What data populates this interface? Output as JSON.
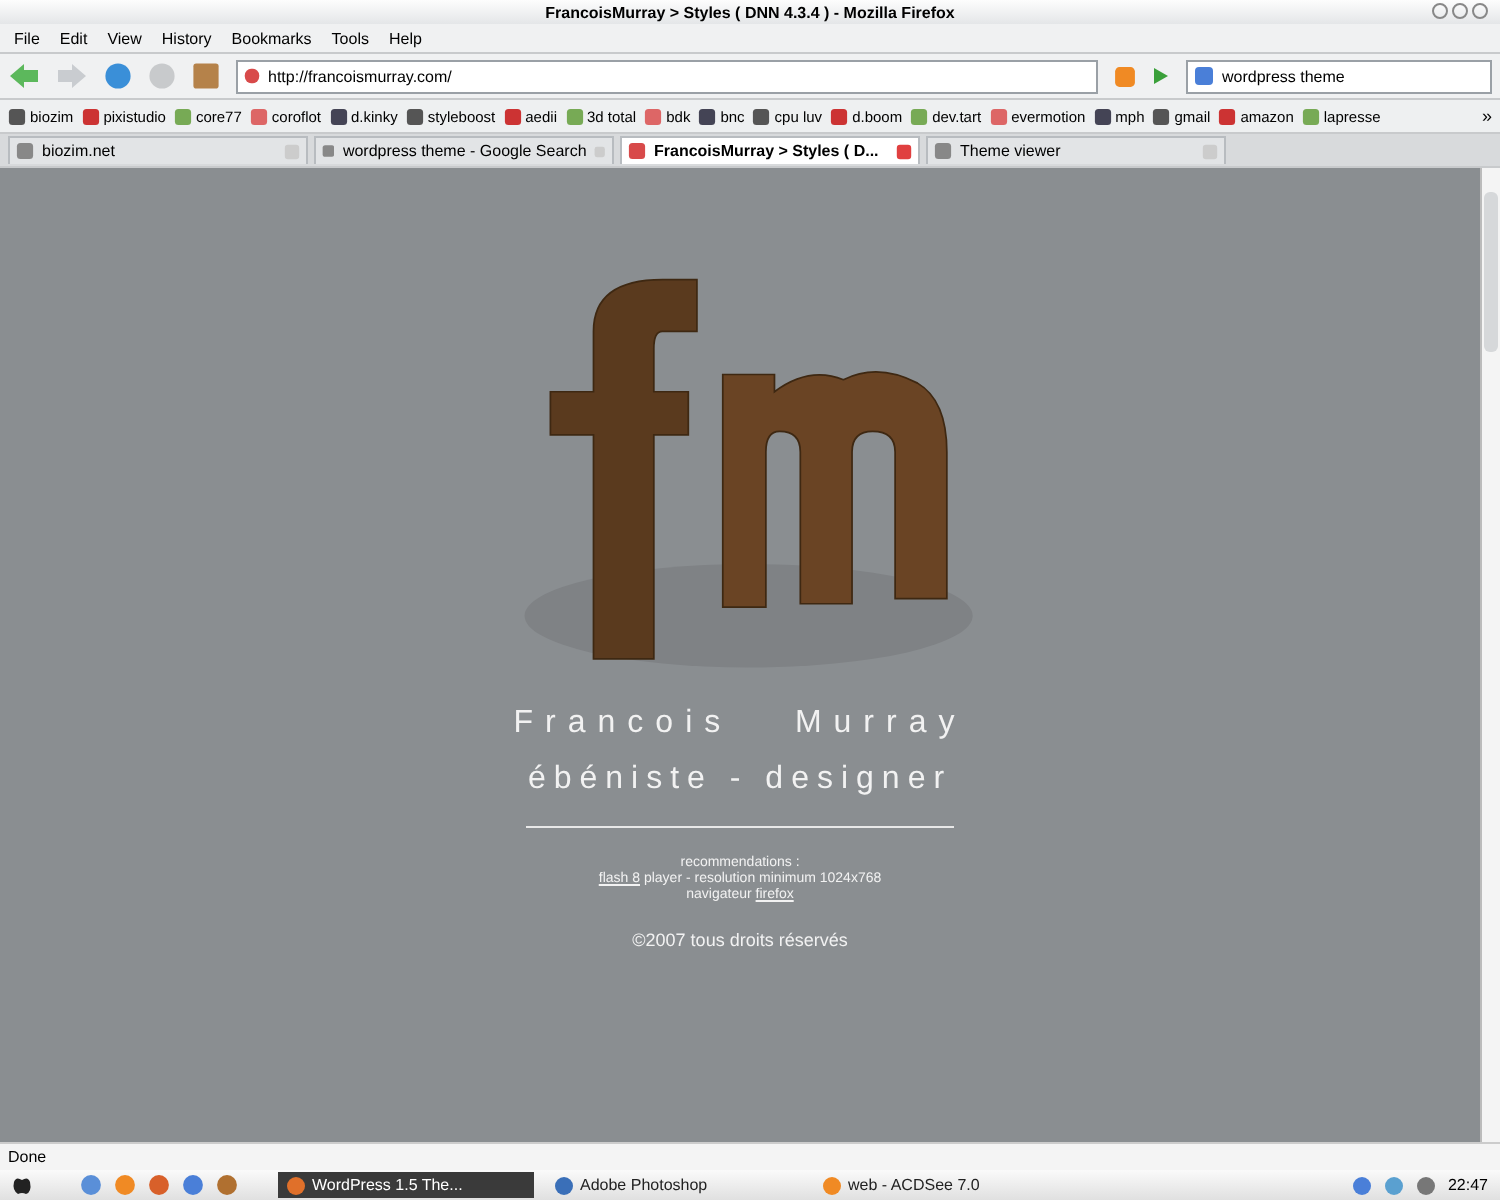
{
  "window": {
    "title": "FrancoisMurray > Styles ( DNN 4.3.4 ) - Mozilla Firefox"
  },
  "menu": [
    "File",
    "Edit",
    "View",
    "History",
    "Bookmarks",
    "Tools",
    "Help"
  ],
  "address": {
    "value": "http://francoismurray.com/"
  },
  "search": {
    "value": "wordpress theme"
  },
  "bookmarks": [
    "biozim",
    "pixistudio",
    "core77",
    "coroflot",
    "d.kinky",
    "styleboost",
    "aedii",
    "3d total",
    "bdk",
    "bnc",
    "cpu luv",
    "d.boom",
    "dev.tart",
    "evermotion",
    "mph",
    "gmail",
    "amazon",
    "lapresse"
  ],
  "bookmarks_more": "»",
  "tabs": [
    {
      "label": "biozim.net",
      "selected": false
    },
    {
      "label": "wordpress theme - Google Search",
      "selected": false
    },
    {
      "label": "FrancoisMurray > Styles ( D...",
      "selected": true
    },
    {
      "label": "Theme viewer",
      "selected": false
    }
  ],
  "page": {
    "name": "Francois   Murray",
    "subtitle": "ébéniste - designer",
    "recommendations": "recommendations :",
    "requirements": [
      {
        "link": "flash 8",
        "text": "player - resolution minimum 1024x768"
      },
      {
        "text": "navigateur",
        "link": "firefox"
      }
    ],
    "copyright": "©2007 tous droits réservés"
  },
  "status_bar": {
    "text": "Done"
  },
  "taskbar": {
    "items": [
      {
        "label": "WordPress 1.5 The...",
        "selected": true
      },
      {
        "label": "Adobe Photoshop",
        "selected": false
      },
      {
        "label": "web - ACDSee 7.0",
        "selected": false
      }
    ],
    "clock": "22:47"
  }
}
